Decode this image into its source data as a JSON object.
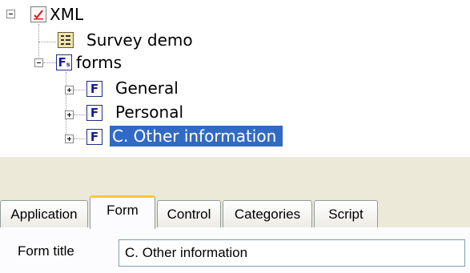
{
  "tree": {
    "root": {
      "label": "XML",
      "icon": "xml-document-icon",
      "expanded": true
    },
    "children": [
      {
        "label": "Survey demo",
        "icon": "survey-list-icon"
      },
      {
        "label": "forms",
        "icon": "forms-folder-icon",
        "expanded": true,
        "children": [
          {
            "label": "General",
            "icon": "form-icon",
            "expanded": false,
            "icon_letter": "F"
          },
          {
            "label": "Personal",
            "icon": "form-icon",
            "expanded": false,
            "icon_letter": "F"
          },
          {
            "label": "C. Other information",
            "icon": "form-icon",
            "expanded": false,
            "selected": true,
            "icon_letter": "F"
          }
        ]
      }
    ],
    "forms_icon_letter": "F",
    "forms_icon_sub": "s"
  },
  "tabs": [
    {
      "label": "Application",
      "active": false
    },
    {
      "label": "Form",
      "active": true
    },
    {
      "label": "Control",
      "active": false
    },
    {
      "label": "Categories",
      "active": false
    },
    {
      "label": "Script",
      "active": false
    }
  ],
  "form": {
    "title_label": "Form title",
    "title_value": "C. Other information"
  },
  "colors": {
    "selection": "#316ac5",
    "active_tab_accent": "#ffc83c",
    "panel_band": "#ece9d8",
    "form_icon": "#1a1a9a"
  }
}
